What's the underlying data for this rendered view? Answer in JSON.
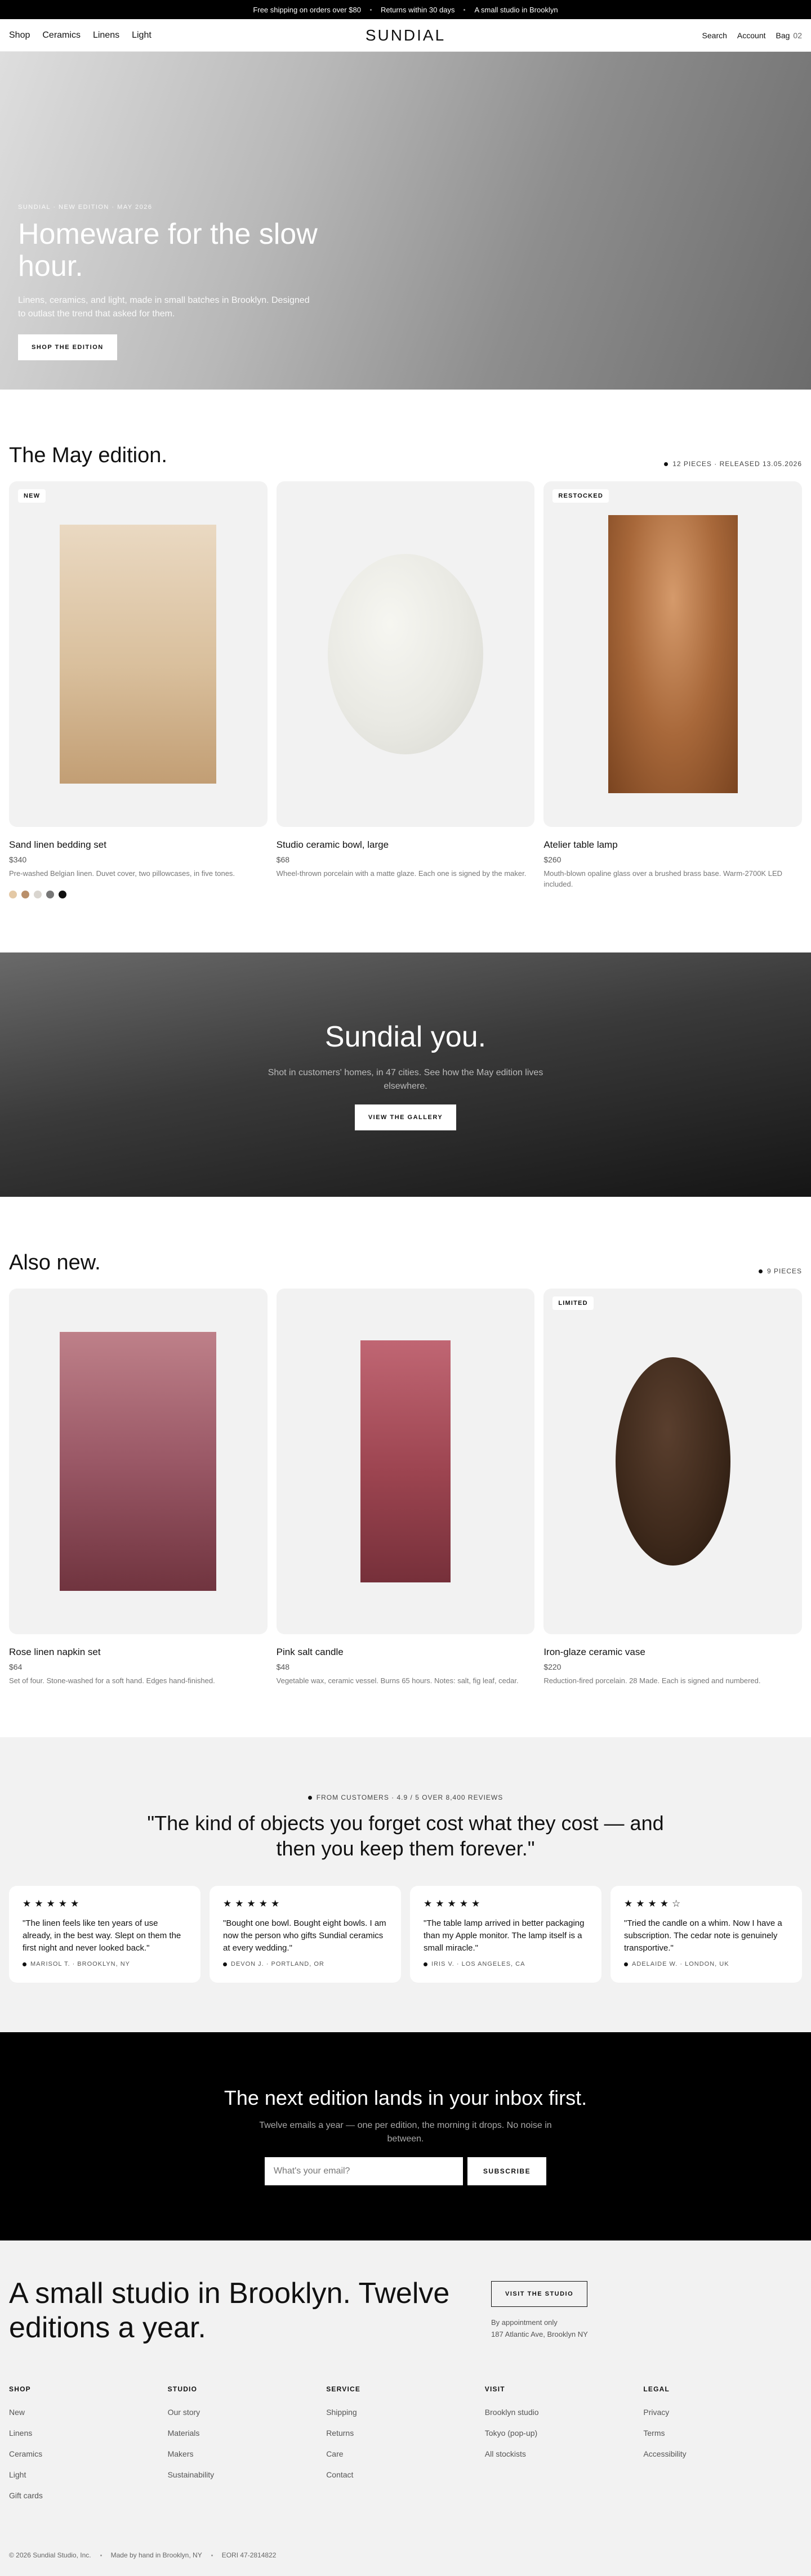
{
  "announcement": [
    "Free shipping on orders over $80",
    "Returns within 30 days",
    "A small studio in Brooklyn"
  ],
  "nav": {
    "left": [
      "Shop",
      "Ceramics",
      "Linens",
      "Light"
    ],
    "logo": "SUNDIAL",
    "search": "Search",
    "account": "Account",
    "bag": "Bag",
    "bag_count": "02"
  },
  "hero": {
    "eyebrow": "SUNDIAL · NEW EDITION · MAY 2026",
    "title": "Homeware for the slow hour.",
    "subtitle": "Linens, ceramics, and light, made in small batches in Brooklyn. Designed to outlast the trend that asked for them.",
    "cta": "SHOP THE EDITION"
  },
  "may": {
    "title": "The May edition.",
    "meta": "12 PIECES · RELEASED 13.05.2026",
    "products": [
      {
        "badge": "NEW",
        "name": "Sand linen bedding set",
        "price": "$340",
        "desc": "Pre-washed Belgian linen. Duvet cover, two pillowcases, in five tones.",
        "swatches": [
          "#e4c9a6",
          "#b98f6a",
          "#d9d5cf",
          "#777777",
          "#111111"
        ]
      },
      {
        "badge": "",
        "name": "Studio ceramic bowl, large",
        "price": "$68",
        "desc": "Wheel-thrown porcelain with a matte glaze. Each one is signed by the maker."
      },
      {
        "badge": "RESTOCKED",
        "name": "Atelier table lamp",
        "price": "$260",
        "desc": "Mouth-blown opaline glass over a brushed brass base. Warm-2700K LED included."
      }
    ]
  },
  "ugc": {
    "title": "Sundial you.",
    "text": "Shot in customers' homes, in 47 cities. See how the May edition lives elsewhere.",
    "cta": "VIEW THE GALLERY"
  },
  "also": {
    "title": "Also new.",
    "meta": "9 PIECES",
    "products": [
      {
        "badge": "",
        "name": "Rose linen napkin set",
        "price": "$64",
        "desc": "Set of four. Stone-washed for a soft hand. Edges hand-finished."
      },
      {
        "badge": "",
        "name": "Pink salt candle",
        "price": "$48",
        "desc": "Vegetable wax, ceramic vessel. Burns 65 hours. Notes: salt, fig leaf, cedar."
      },
      {
        "badge": "LIMITED",
        "name": "Iron-glaze ceramic vase",
        "price": "$220",
        "desc": "Reduction-fired porcelain. 28 Made. Each is signed and numbered."
      }
    ]
  },
  "reviews": {
    "summary": "FROM CUSTOMERS · 4.9 / 5 OVER 8,400 REVIEWS",
    "quote": "\"The kind of objects you forget cost what they cost — and then you keep them forever.\"",
    "items": [
      {
        "stars": "★★★★★",
        "text": "\"The linen feels like ten years of use already, in the best way. Slept on them the first night and never looked back.\"",
        "by": "MARISOL T. · BROOKLYN, NY"
      },
      {
        "stars": "★★★★★",
        "text": "\"Bought one bowl. Bought eight bowls. I am now the person who gifts Sundial ceramics at every wedding.\"",
        "by": "DEVON J. · PORTLAND, OR"
      },
      {
        "stars": "★★★★★",
        "text": "\"The table lamp arrived in better packaging than my Apple monitor. The lamp itself is a small miracle.\"",
        "by": "IRIS V. · LOS ANGELES, CA"
      },
      {
        "stars": "★★★★☆",
        "text": "\"Tried the candle on a whim. Now I have a subscription. The cedar note is genuinely transportive.\"",
        "by": "ADELAIDE W. · LONDON, UK"
      }
    ]
  },
  "newsletter": {
    "title": "The next edition lands in your inbox first.",
    "text": "Twelve emails a year — one per edition, the morning it drops. No noise in between.",
    "placeholder": "What's your email?",
    "button": "SUBSCRIBE"
  },
  "footer": {
    "headline": "A small studio in Brooklyn. Twelve editions a year.",
    "visit": "VISIT THE STUDIO",
    "addr1": "By appointment only",
    "addr2": "187 Atlantic Ave, Brooklyn NY",
    "cols": [
      {
        "title": "SHOP",
        "links": [
          "New",
          "Linens",
          "Ceramics",
          "Light",
          "Gift cards"
        ]
      },
      {
        "title": "STUDIO",
        "links": [
          "Our story",
          "Materials",
          "Makers",
          "Sustainability"
        ]
      },
      {
        "title": "SERVICE",
        "links": [
          "Shipping",
          "Returns",
          "Care",
          "Contact"
        ]
      },
      {
        "title": "VISIT",
        "links": [
          "Brooklyn studio",
          "Tokyo (pop-up)",
          "All stockists"
        ]
      },
      {
        "title": "LEGAL",
        "links": [
          "Privacy",
          "Terms",
          "Accessibility"
        ]
      }
    ],
    "legal": [
      "© 2026 Sundial Studio, Inc.",
      "Made by hand in Brooklyn, NY",
      "EORI 47-2814822"
    ]
  }
}
